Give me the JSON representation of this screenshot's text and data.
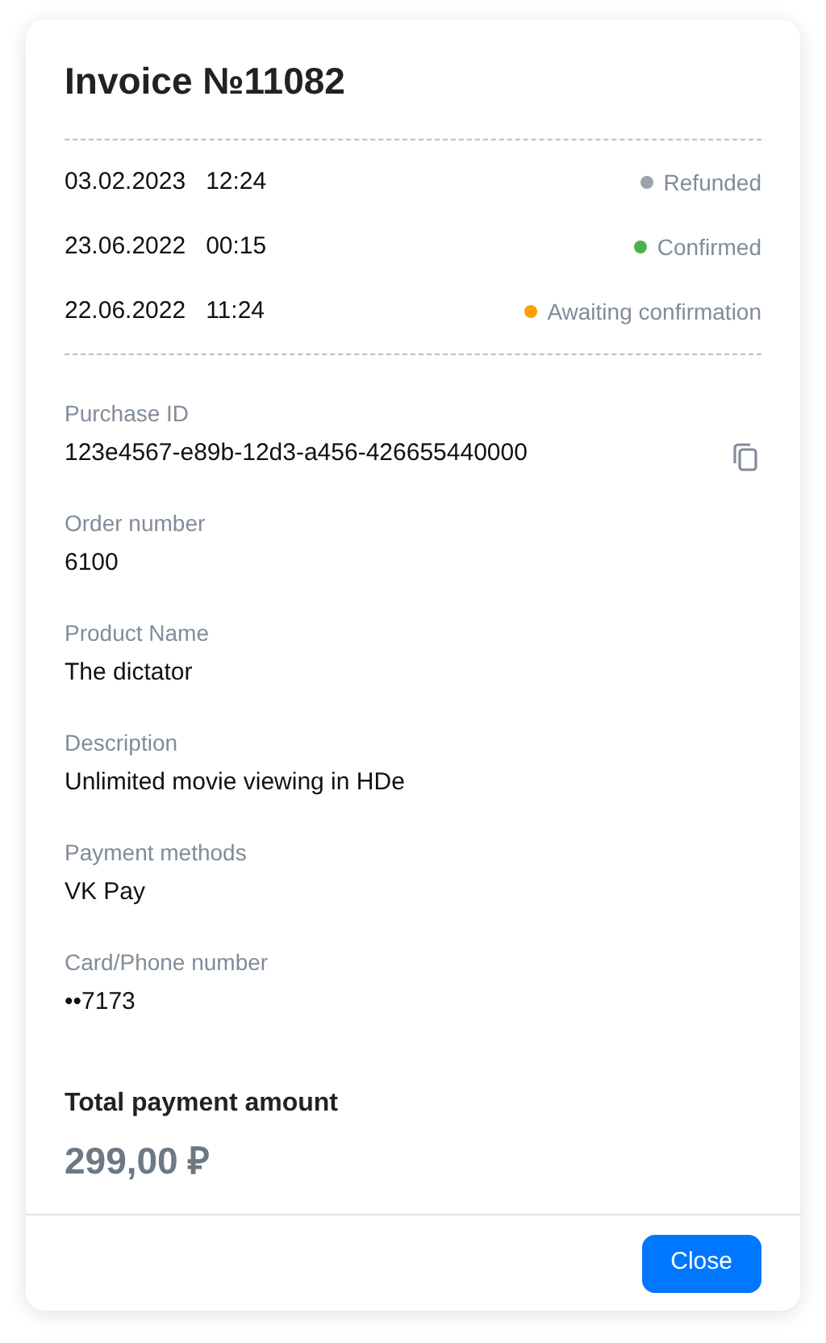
{
  "title": "Invoice №11082",
  "history": [
    {
      "date": "03.02.2023",
      "time": "12:24",
      "status": "Refunded",
      "color": "#99a2ad"
    },
    {
      "date": "23.06.2022",
      "time": "00:15",
      "status": "Confirmed",
      "color": "#4bb34b"
    },
    {
      "date": "22.06.2022",
      "time": "11:24",
      "status": "Awaiting confirmation",
      "color": "#ffa000"
    }
  ],
  "fields": [
    {
      "label": "Purchase ID",
      "value": "123e4567-e89b-12d3-a456-426655440000",
      "copyable": true
    },
    {
      "label": "Order number",
      "value": "6100",
      "copyable": false
    },
    {
      "label": "Product Name",
      "value": "The dictator",
      "copyable": false
    },
    {
      "label": "Description",
      "value": "Unlimited movie viewing in HDe",
      "copyable": false
    },
    {
      "label": "Payment methods",
      "value": "VK Pay",
      "copyable": false
    },
    {
      "label": "Card/Phone number",
      "value": "••7173",
      "copyable": false
    }
  ],
  "total": {
    "label": "Total payment amount",
    "amount": "299,00 ₽"
  },
  "buttons": [
    "Close"
  ]
}
